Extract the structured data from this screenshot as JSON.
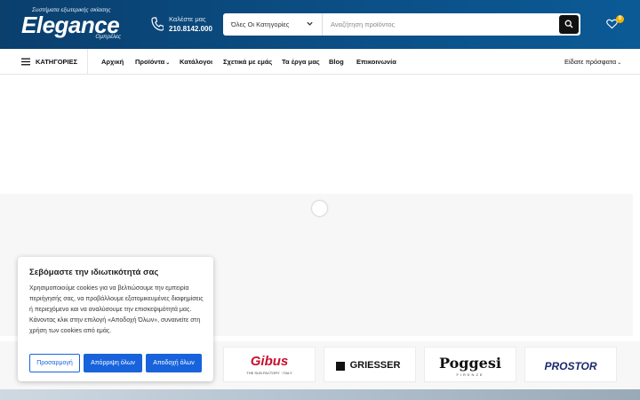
{
  "header": {
    "logo": {
      "tagline": "Συστήματα εξωτερικής σκίασης",
      "word": "Elegance",
      "sub": "Ομπρέλες"
    },
    "phone": {
      "label": "Καλέστε μας",
      "number": "210.8142.000"
    },
    "search": {
      "category": "Όλες Οι Κατηγορίες",
      "placeholder": "Αναζήτηση προϊόντος",
      "value": ""
    },
    "wishlist_count": "0"
  },
  "nav": {
    "categories_label": "ΚΑΤΗΓΟΡΙΕΣ",
    "items": [
      {
        "label": "Αρχική",
        "dropdown": false
      },
      {
        "label": "Προϊόντα",
        "dropdown": true
      },
      {
        "label": "Κατάλογοι",
        "dropdown": false
      },
      {
        "label": "Σχετικά με εμάς",
        "dropdown": false
      },
      {
        "label": "Τα έργα μας",
        "dropdown": false
      },
      {
        "label": "Blog",
        "dropdown": false
      },
      {
        "label": "Επικοινωνία",
        "dropdown": false
      }
    ],
    "recent": "Είδατε πρόσφατα"
  },
  "brands": [
    {
      "name": "Gibus",
      "tag": "THE SUN FACTORY · ITALY"
    },
    {
      "name": "GRIESSER",
      "tag": ""
    },
    {
      "name": "Poggesi",
      "tag": "FIRENZE"
    },
    {
      "name": "PROSTOR",
      "tag": ""
    }
  ],
  "cookie": {
    "title": "Σεβόμαστε την ιδιωτικότητά σας",
    "body": "Χρησιμοποιούμε cookies για να βελτιώσουμε την εμπειρία περιήγησής σας, να προβάλλουμε εξατομικευμένες διαφημίσεις ή περιεχόμενο και να αναλύσουμε την επισκεψιμότητά μας. Κάνοντας κλικ στην επιλογή «Αποδοχή Όλων», συναινείτε στη χρήση των cookies από εμάς.",
    "customize": "Προσαρμογή",
    "reject": "Απόρριψη όλων",
    "accept": "Αποδοχή όλων"
  },
  "colors": {
    "header": "#0b4f86",
    "accent_button": "#1863dc",
    "badge": "#f0b400"
  }
}
